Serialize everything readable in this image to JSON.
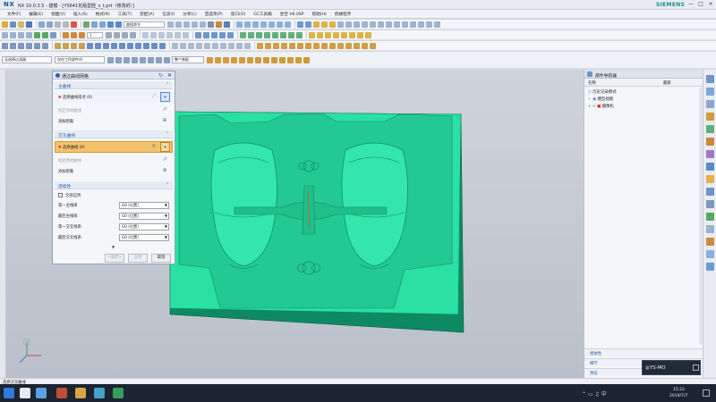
{
  "window": {
    "app_logo": "NX",
    "title": "NX 10.0.3.5 - 建模 - [YS641花瓶型腔_s_t.prt（修改的）]",
    "brand": "SIEMENS",
    "controls": [
      "—",
      "□",
      "×"
    ]
  },
  "menubar": {
    "items": [
      "文件(F)",
      "编辑(E)",
      "视图(V)",
      "插入(S)",
      "格式(R)",
      "工具(T)",
      "装配(A)",
      "信息(I)",
      "分析(L)",
      "首选项(P)",
      "窗口(O)",
      "GC工具箱",
      "星空 V6.0SP",
      "帮助(H)",
      "机械程序"
    ]
  },
  "toolbar": {
    "command_finder_placeholder": "查找命令",
    "selection_filter": "无选择过滤器",
    "assembly_scope": "仅在工作部件内",
    "snap_combo": "整个装配",
    "layer_value": "1"
  },
  "dialog": {
    "title": "通过曲线网格",
    "primary_section": "主曲线",
    "primary_select": "选择曲线或点 (0)",
    "primary_specify": "指定原始曲线",
    "primary_add": "添加新集",
    "cross_section": "交叉曲线",
    "cross_select": "选择曲线 (0)",
    "cross_specify": "指定原始曲线",
    "cross_add": "添加新集",
    "continuity_section": "连续性",
    "apply_all": "全部应用",
    "rows": [
      {
        "label": "第一主线串",
        "value": "G0 (位置)"
      },
      {
        "label": "最后主线串",
        "value": "G0 (位置)"
      },
      {
        "label": "第一交叉线串",
        "value": "G0 (位置)"
      },
      {
        "label": "最后交叉线串",
        "value": "G0 (位置)"
      }
    ],
    "ok_label": "<确定>",
    "apply_label": "应用",
    "cancel_label": "取消"
  },
  "navigator": {
    "title": "部件导航器",
    "col_name": "名称",
    "col_latest": "最新",
    "items": [
      "历史记录模式",
      "模型视图",
      "摄像机"
    ],
    "bottom_panels": [
      "相依性",
      "细节",
      "预览"
    ]
  },
  "cue_line": "选择交叉曲线",
  "ime": "YS-MO",
  "clock": {
    "time": "15:22",
    "date": "2019/7/7"
  },
  "colors": {
    "mold": "#2ae0a3",
    "mold_dark": "#0e8a63",
    "dialog_highlight": "#f4c26c",
    "accent": "#2b61a6"
  }
}
